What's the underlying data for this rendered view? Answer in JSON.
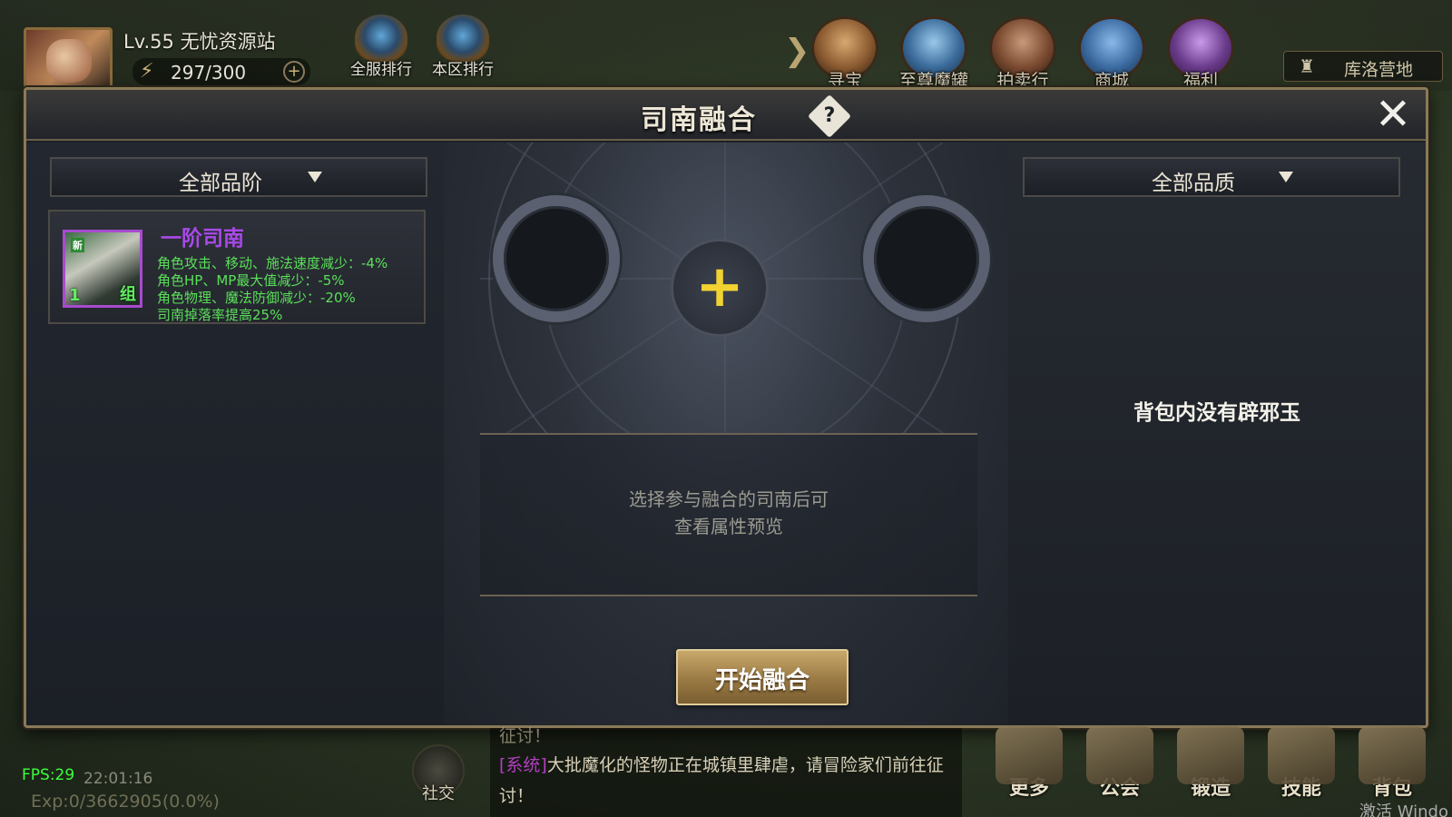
{
  "player": {
    "name": "Lv.55  无忧资源站",
    "energy": "297/300"
  },
  "top_ranks": [
    {
      "label": "全服排行"
    },
    {
      "label": "本区排行"
    }
  ],
  "top_menu": [
    {
      "label": "寻宝",
      "color": "#8a5a30"
    },
    {
      "label": "至尊魔罐",
      "color": "#3a6a9a"
    },
    {
      "label": "拍卖行",
      "color": "#7a4a30"
    },
    {
      "label": "商城",
      "color": "#3a6aa0"
    },
    {
      "label": "福利",
      "color": "#6a3a8a"
    }
  ],
  "camp": {
    "label": "库洛营地"
  },
  "dialog": {
    "title": "司南融合",
    "help": "?",
    "close": "✕",
    "grade_filter": "全部品阶",
    "quality_filter": "全部品质",
    "item": {
      "name": "一阶司南",
      "badge": "新",
      "count": "1",
      "unit": "组",
      "attributes": [
        "角色攻击、移动、施法速度减少：-4%",
        "角色HP、MP最大值减少：-5%",
        "角色物理、魔法防御减少：-20%",
        "司南掉落率提高25%"
      ]
    },
    "plus": "+",
    "preview_line1": "选择参与融合的司南后可",
    "preview_line2": "查看属性预览",
    "fuse_button": "开始融合",
    "empty_note": "背包内没有辟邪玉"
  },
  "bottom": {
    "fps": "FPS:29",
    "clock": "22:01:16",
    "exp": "Exp:0/3662905(0.0%)",
    "social": "社交",
    "chat_prev": "征讨！",
    "chat_tag": "[系统]",
    "chat_text": "大批魔化的怪物正在城镇里肆虐，请冒险家们前往征讨！",
    "dock": [
      {
        "label": "更多"
      },
      {
        "label": "公会"
      },
      {
        "label": "锻造"
      },
      {
        "label": "技能"
      },
      {
        "label": "背包"
      }
    ],
    "watermark": "激活 Windo"
  }
}
